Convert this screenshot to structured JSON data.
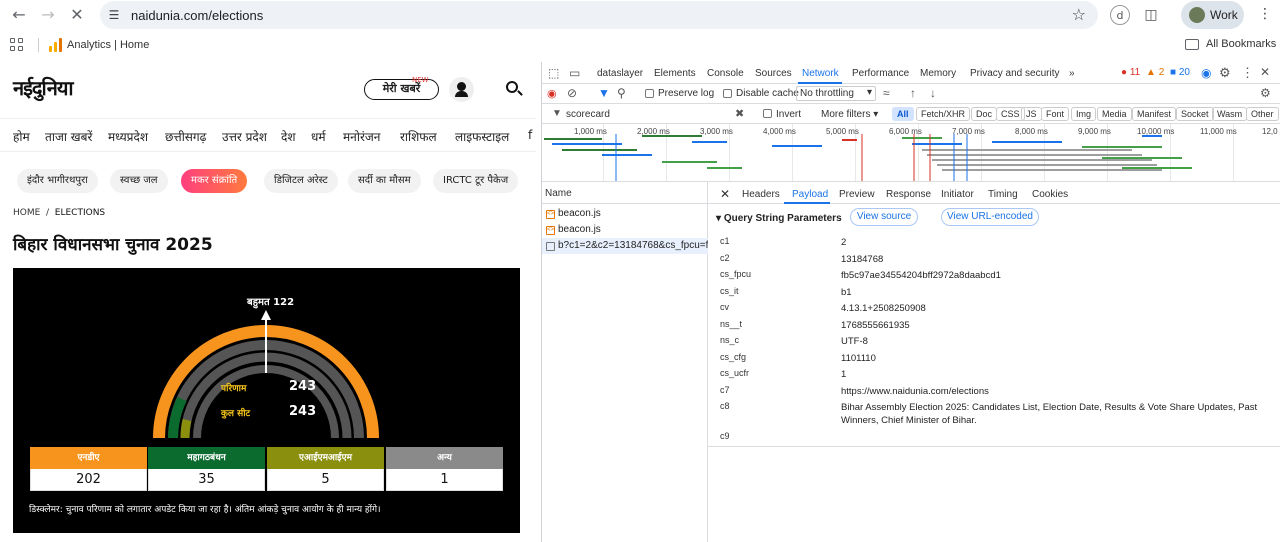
{
  "browser": {
    "url": "naidunia.com/elections",
    "profile_label": "Work",
    "bookmark_label": "Analytics | Home",
    "all_bookmarks_label": "All Bookmarks"
  },
  "site": {
    "logo": "नईदुनिया",
    "meri_khabar": "मेरी खबरें",
    "new_badge": "NEW",
    "nav": [
      "होम",
      "ताजा खबरें",
      "मध्यप्रदेश",
      "छत्तीसगढ़",
      "उत्तर प्रदेश",
      "देश",
      "धर्म",
      "मनोरंजन",
      "राशिफल",
      "लाइफस्टाइल",
      "f"
    ],
    "chips": [
      "इंदौर भागीरथपुरा",
      "स्वच्छ जल",
      "मकर संक्रांति",
      "डिजिटल अरेस्ट",
      "सर्दी का मौसम",
      "IRCTC टूर पैकेज"
    ],
    "breadcrumb_home": "HOME",
    "breadcrumb_current": "ELECTIONS",
    "headline": "बिहार विधानसभा चुनाव 2025",
    "majority_label": "बहुमत 122",
    "result_label": "परिणाम",
    "result_value": "243",
    "total_label": "कुल सीट",
    "total_value": "243",
    "tally": [
      {
        "name": "एनडीए",
        "value": "202",
        "color": "#f7941d"
      },
      {
        "name": "महागठबंधन",
        "value": "35",
        "color": "#0b6b2f"
      },
      {
        "name": "एआईएमआईएम",
        "value": "5",
        "color": "#8a8f0e"
      },
      {
        "name": "अन्य",
        "value": "1",
        "color": "#8a8a8a"
      }
    ],
    "disclaimer": "डिस्क्लेमर: चुनाव परिणाम को लगातार अपडेट किया जा रहा है। अंतिम आंकड़े चुनाव आयोग के ही मान्य होंगे।"
  },
  "devtools": {
    "tabs": [
      "dataslayer",
      "Elements",
      "Console",
      "Sources",
      "Network",
      "Performance",
      "Memory",
      "Privacy and security"
    ],
    "more_tabs": "»",
    "errors": "11",
    "warnings": "2",
    "issues": "20",
    "preserve_log": "Preserve log",
    "disable_cache": "Disable cache",
    "throttling": "No throttling",
    "filter_value": "scorecard",
    "invert": "Invert",
    "more_filters": "More filters",
    "filter_types": [
      "All",
      "Fetch/XHR",
      "Doc",
      "CSS",
      "JS",
      "Font",
      "Img",
      "Media",
      "Manifest",
      "Socket",
      "Wasm",
      "Other"
    ],
    "timeline_labels": [
      "1,000 ms",
      "2,000 ms",
      "3,000 ms",
      "4,000 ms",
      "5,000 ms",
      "6,000 ms",
      "7,000 ms",
      "8,000 ms",
      "9,000 ms",
      "10,000 ms",
      "11,000 ms",
      "12,0"
    ],
    "name_header": "Name",
    "requests": [
      "beacon.js",
      "beacon.js",
      "b?c1=2&c2=13184768&cs_fpcu=f..."
    ],
    "detail_tabs": [
      "Headers",
      "Payload",
      "Preview",
      "Response",
      "Initiator",
      "Timing",
      "Cookies"
    ],
    "section_title": "Query String Parameters",
    "view_source": "View source",
    "view_url_encoded": "View URL-encoded",
    "params": [
      {
        "key": "c1",
        "value": "2"
      },
      {
        "key": "c2",
        "value": "13184768"
      },
      {
        "key": "cs_fpcu",
        "value": "fb5c97ae34554204bff2972a8daabcd1"
      },
      {
        "key": "cs_it",
        "value": "b1"
      },
      {
        "key": "cv",
        "value": "4.13.1+2508250908"
      },
      {
        "key": "ns__t",
        "value": "1768555661935"
      },
      {
        "key": "ns_c",
        "value": "UTF-8"
      },
      {
        "key": "cs_cfg",
        "value": "1101110"
      },
      {
        "key": "cs_ucfr",
        "value": "1"
      },
      {
        "key": "c7",
        "value": "https://www.naidunia.com/elections"
      },
      {
        "key": "c8",
        "value": "Bihar Assembly Election 2025: Candidates List, Election Date, Results & Vote Share Updates, Past Winners, Chief Minister of Bihar."
      },
      {
        "key": "c9",
        "value": ""
      }
    ]
  }
}
